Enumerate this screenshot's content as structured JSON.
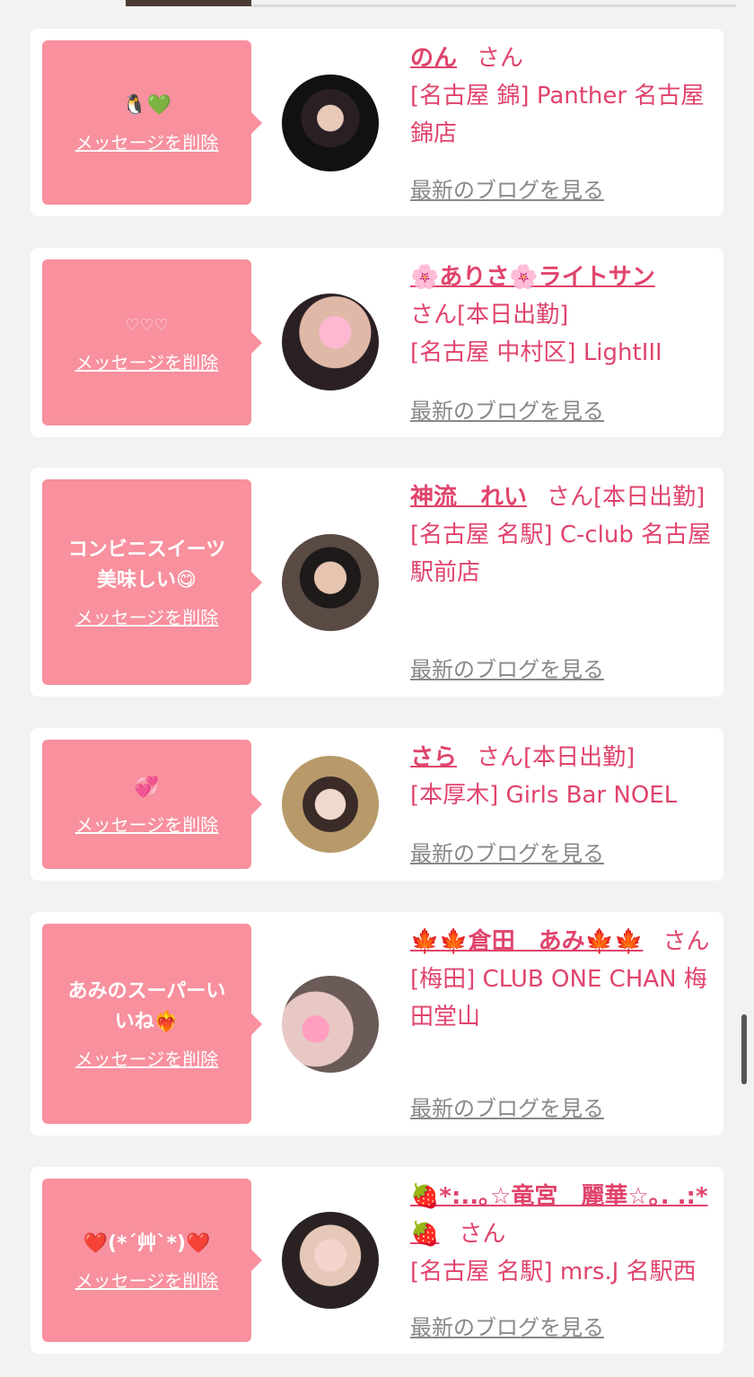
{
  "delete_label": "メッセージを削除",
  "blog_label": "最新のブログを見る",
  "san_label": "さん",
  "colors": {
    "bubble": "#f8909e",
    "accent": "#e0446c",
    "card": "#ffffff",
    "background": "#f2f2f2"
  },
  "cards": [
    {
      "message": "🐧💚",
      "name": "のん",
      "suffix": "",
      "store": "[名古屋 錦] Panther 名古屋錦店"
    },
    {
      "message": "♡♡♡",
      "name": "🌸ありさ🌸ライトサン",
      "suffix": "[本日出勤]",
      "store": "[名古屋 中村区] LightIII"
    },
    {
      "message": "コンビニスイーツ\n美味しい😋",
      "name": "神流　れい",
      "suffix": "[本日出勤]",
      "store": "[名古屋 名駅] C-club 名古屋駅前店"
    },
    {
      "message": "💞",
      "name": "さら",
      "suffix": "[本日出勤]",
      "store": "[本厚木] Girls Bar NOEL"
    },
    {
      "message": "あみのスーパーい\nいね❤️‍🔥",
      "name": "🍁🍁倉田　あみ🍁🍁",
      "suffix": "",
      "store": "[梅田] CLUB ONE CHAN 梅田堂山"
    },
    {
      "message": "❤️(*´艸`*)❤️",
      "name": "🍓*:..｡☆竜宮　麗華☆｡. .:*🍓",
      "suffix": "",
      "store": "[名古屋 名駅] mrs.J 名駅西"
    }
  ]
}
